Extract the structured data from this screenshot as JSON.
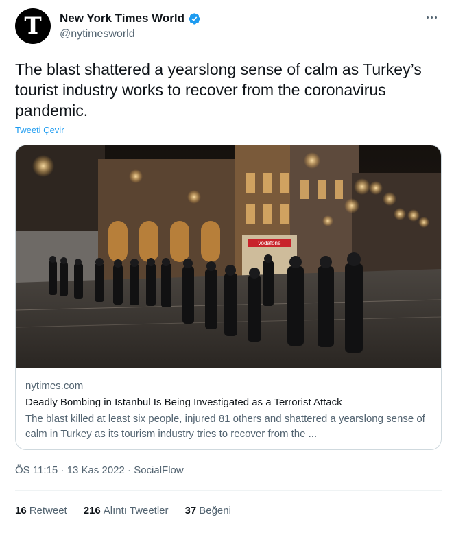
{
  "author": {
    "name": "New York Times World",
    "handle": "@nytimesworld",
    "avatar_letter": "T",
    "verified": true
  },
  "tweet": {
    "text": "The blast shattered a yearslong sense of calm as Turkey’s tourist industry works to recover from the coronavirus pandemic.",
    "translate_label": "Tweeti Çevir"
  },
  "card": {
    "domain": "nytimes.com",
    "title": "Deadly Bombing in Istanbul Is Being Investigated as a Terrorist Attack",
    "description": "The blast killed at least six people, injured 81 others and shattered a yearslong sense of calm in Turkey as its tourism industry tries to recover from the ...",
    "image_sign_text": "vodafone"
  },
  "meta": {
    "time": "ÖS 11:15",
    "separator": "·",
    "date": "13 Kas 2022",
    "source": "SocialFlow"
  },
  "stats": [
    {
      "count": "16",
      "label": "Retweet"
    },
    {
      "count": "216",
      "label": "Alıntı Tweetler"
    },
    {
      "count": "37",
      "label": "Beğeni"
    }
  ],
  "colors": {
    "link": "#1d9bf0",
    "secondary_text": "#536471",
    "border": "#cfd9de"
  }
}
